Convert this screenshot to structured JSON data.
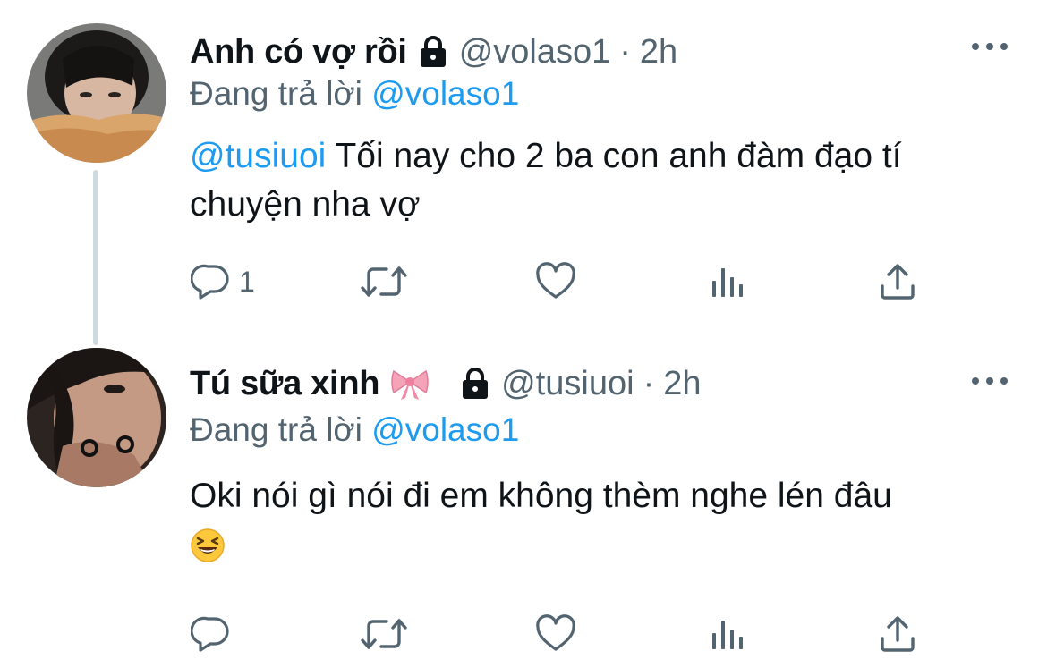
{
  "tweets": [
    {
      "name": "Anh có vợ rồi",
      "handle": "@volaso1",
      "dot": "·",
      "time": "2h",
      "replying_prefix": "Đang trả lời",
      "replying_to": "@volaso1",
      "mention": "@tusiuoi",
      "text": " Tối nay cho 2 ba con anh đàm đạo tí chuyện nha vợ",
      "reply_count": "1",
      "icons": [
        "lock-icon",
        "more-icon",
        "reply-icon",
        "retweet-icon",
        "like-icon",
        "views-icon",
        "share-icon"
      ]
    },
    {
      "name": "Tú sữa xinh",
      "handle": "@tusiuoi",
      "dot": "·",
      "time": "2h",
      "replying_prefix": "Đang trả lời",
      "replying_to": "@volaso1",
      "text": "Oki nói gì nói đi em không thèm nghe lén đâu",
      "reply_count": "",
      "icons": [
        "ribbon-emoji-icon",
        "lock-icon",
        "more-icon",
        "laughing-emoji-icon",
        "reply-icon",
        "retweet-icon",
        "like-icon",
        "views-icon",
        "share-icon"
      ]
    }
  ],
  "colors": {
    "text": "#0f1419",
    "secondary": "#536471",
    "link": "#1d9bf0",
    "thread_line": "#cfd9de"
  }
}
